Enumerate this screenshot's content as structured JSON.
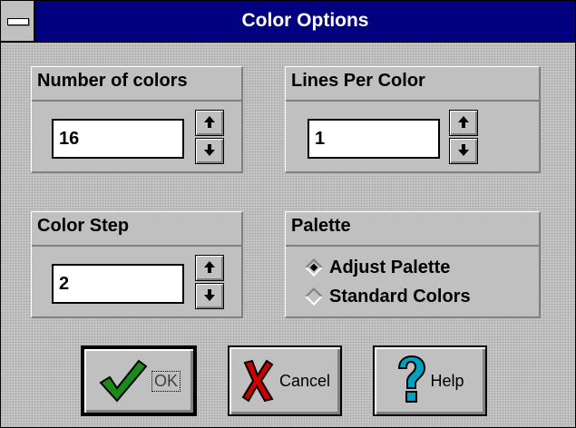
{
  "window": {
    "title": "Color Options"
  },
  "groups": {
    "num_colors": {
      "label": "Number of colors",
      "value": "16"
    },
    "lines_per_color": {
      "label": "Lines Per Color",
      "value": "1"
    },
    "color_step": {
      "label": "Color Step",
      "value": "2"
    },
    "palette": {
      "label": "Palette",
      "options": [
        {
          "label": "Adjust Palette",
          "selected": true
        },
        {
          "label": "Standard Colors",
          "selected": false
        }
      ]
    }
  },
  "buttons": {
    "ok": "OK",
    "cancel": "Cancel",
    "help": "Help"
  },
  "colors": {
    "titlebar": "#000080",
    "check": "#1a8a1a",
    "x_mark": "#cc0000",
    "help": "#00a0c0"
  }
}
